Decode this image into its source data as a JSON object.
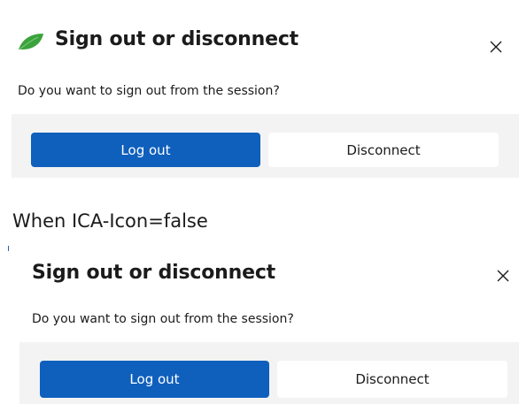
{
  "dialog_with_icon": {
    "title": "Sign out or disconnect",
    "message": "Do you want to sign out from the session?",
    "primary_button": "Log out",
    "secondary_button": "Disconnect",
    "icon": "leaf-icon",
    "close_icon": "close-icon"
  },
  "caption": "When ICA-Icon=false",
  "dialog_without_icon": {
    "title": "Sign out or disconnect",
    "message": "Do you want to sign out from the session?",
    "primary_button": "Log out",
    "secondary_button": "Disconnect",
    "close_icon": "close-icon"
  },
  "colors": {
    "accent": "#0f5fbd",
    "leaf": "#3aa33b",
    "footer_bg": "#f3f3f3"
  }
}
